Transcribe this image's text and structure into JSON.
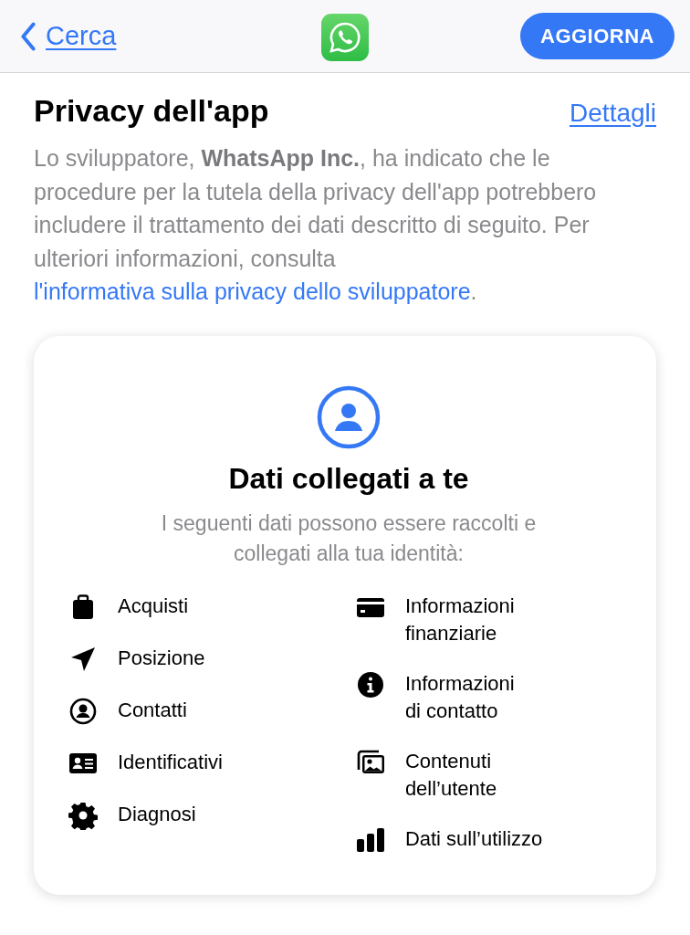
{
  "nav": {
    "back": "Cerca",
    "button": "AGGIORNA"
  },
  "section": {
    "title": "Privacy dell'app",
    "link": "Dettagli"
  },
  "description": {
    "text": "Lo sviluppatore, **WhatsApp Inc.**, ha indicato che le procedure per la tutela della privacy dell'app potrebbero includere il trattamento dei dati descritto di seguito. Per ulteriori informazioni, consulta ",
    "link": "l'informativa sulla privacy dello sviluppatore",
    "after": "."
  },
  "card": {
    "title": "Dati collegati a te",
    "subtitle": "I seguenti dati possono essere raccolti e collegati alla tua identità:",
    "left": [
      {
        "kind": "bag",
        "label": "Acquisti"
      },
      {
        "kind": "location",
        "label": "Posizione"
      },
      {
        "kind": "contact",
        "label": "Contatti"
      },
      {
        "kind": "idcard",
        "label": "Identificativi"
      },
      {
        "kind": "gear",
        "label": "Diagnosi"
      }
    ],
    "right": [
      {
        "kind": "card",
        "label": "Informazioni\nfinanziarie"
      },
      {
        "kind": "info",
        "label": "Informazioni\ndi contatto"
      },
      {
        "kind": "photos",
        "label": "Contenuti\ndell’utente"
      },
      {
        "kind": "chart",
        "label": "Dati sull’utilizzo"
      }
    ]
  }
}
